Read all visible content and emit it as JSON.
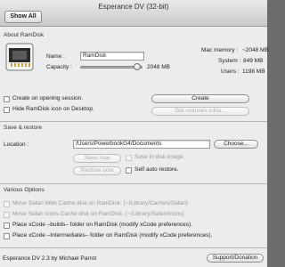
{
  "window": {
    "title": "Esperance DV (32-bit)"
  },
  "toolbar": {
    "show_all_label": "Show All"
  },
  "about": {
    "section_title": "About RamDisk",
    "name_label": "Name :",
    "name_value": "RamDisk",
    "capacity_label": "Capacity :",
    "capacity_value": "2048 MB",
    "capacity_fraction": 0.92,
    "mac_memory_label": "Mac memory :",
    "mac_memory_value": "~2048 MB",
    "system_label": "System :",
    "system_value": "849 MB",
    "users_label": "Users :",
    "users_value": "1198 MB",
    "create_on_open_label": "Create on opening session.",
    "hide_icon_label": "Hide RamDisk icon on Desktop.",
    "create_button": "Create",
    "get_volumes_button": "Get volumes infos..."
  },
  "save": {
    "section_title": "Save & restore",
    "location_label": "Location :",
    "location_value": "/Users/PowerbookG4/Documents",
    "choose_button": "Choose...",
    "save_now_button": "Save now",
    "save_in_disk_image_label": "Save in disk image.",
    "restore_now_button": "Restore now",
    "self_auto_restore_label": "Self auto restore."
  },
  "options": {
    "section_title": "Various Options",
    "items": [
      {
        "label": "Move Safari Web Cache disk on RamDisk. (~/Library/Caches/Safari)",
        "enabled": false
      },
      {
        "label": "Move Safari Icons Cache disk on RamDisk. (~/Library/Safari/Icons)",
        "enabled": false
      },
      {
        "label": "Place xCode –builds– folder on RamDisk (modify xCode preferences).",
        "enabled": true
      },
      {
        "label": "Place xCode –Intermediates– folder on RamDisk (modify xCode preferences).",
        "enabled": true
      }
    ]
  },
  "footer": {
    "credit": "Esperance DV 2.3 by Michael Parrot",
    "support_button": "Support/Donation"
  }
}
